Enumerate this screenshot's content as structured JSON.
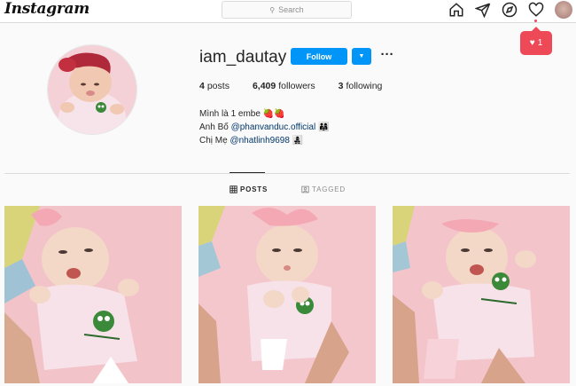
{
  "nav": {
    "logo": "Instagram",
    "search_placeholder": "Search",
    "icons": [
      "home-icon",
      "direct-icon",
      "explore-icon",
      "activity-heart-icon",
      "profile-avatar"
    ],
    "notification_count": "1"
  },
  "profile": {
    "username": "iam_dautay",
    "follow_label": "Follow",
    "posts_count": "4",
    "posts_label": "posts",
    "followers_count": "6,409",
    "followers_label": "followers",
    "following_count": "3",
    "following_label": "following",
    "bio": {
      "line1": "Mình là 1 embe 🍓🍓",
      "line2_prefix": "Anh Bố ",
      "line2_mention": "@phanvanduc.official",
      "line2_suffix": " 👨‍👩‍👧",
      "line3_prefix": "Chị Mẹ ",
      "line3_mention": "@nhatlinh9698",
      "line3_suffix": " 👩‍👧‍👦"
    }
  },
  "tabs": [
    {
      "label": "POSTS",
      "active": true
    },
    {
      "label": "TAGGED",
      "active": false
    }
  ],
  "colors": {
    "follow_blue": "#0095f6",
    "notification_red": "#ed4956",
    "mention_blue": "#00376b"
  }
}
